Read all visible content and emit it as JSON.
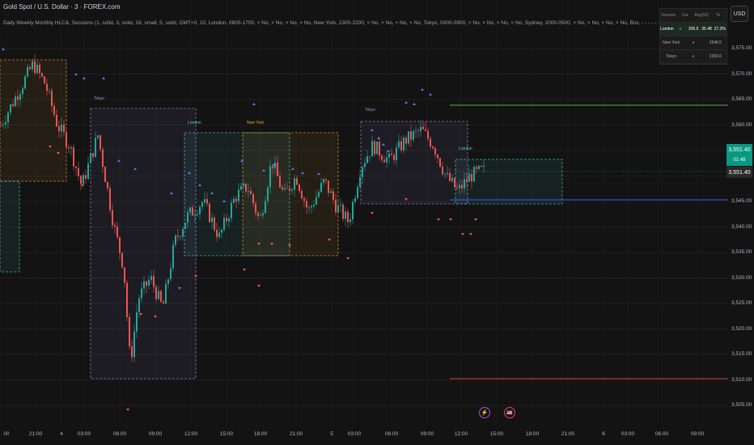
{
  "header": {
    "title": "Gold Spot / U.S. Dollar · 3 · FOREX.com",
    "indicator": "Daily Weekly Monthly HLC&, Sessions (1, solid, 3, solid, 16, small, 5, solid, GMT+0, 10, London, 0800-1700, × No, × No, × No, × No, New York, 1300-2200, × No, × No, × No, × No, Tokyo, 0000-0900, × No, × No, × No, × No, Sydney, 2000-0500, × No, × No, × No, × No, Box, - - - - - -, 1, Small, Top, Outside, 15, small, Red ▾ Green, price, price, white, OHLC, 1, Session color"
  },
  "currency_button": "USD",
  "session_table": {
    "headers": [
      "Session",
      "Cur",
      "Avg(50)",
      "%"
    ],
    "rows": [
      {
        "name": "London",
        "status": "●",
        "cur": "305.5",
        "avg": "35.48",
        "pct": "27.3%",
        "active": true
      },
      {
        "name": "New York",
        "status": "●",
        "cur": "",
        "avg": "2648.5",
        "pct": "",
        "active": false
      },
      {
        "name": "Tokyo",
        "status": "●",
        "cur": "",
        "avg": "2266.6",
        "pct": "",
        "active": false
      }
    ]
  },
  "price_axis": [
    "3,575.00",
    "3,570.00",
    "3,565.00",
    "3,560.00",
    "3,555.00",
    "3,550.00",
    "3,545.00",
    "3,540.00",
    "3,535.00",
    "3,530.00",
    "3,525.00",
    "3,520.00",
    "3,515.00",
    "3,510.00",
    "3,505.00"
  ],
  "current_price": "3,551.40",
  "countdown": "01:48",
  "secondary_price": "3,551.40",
  "time_axis": [
    "00",
    "21:00",
    "4",
    "03:00",
    "06:00",
    "09:00",
    "12:00",
    "15:00",
    "18:00",
    "21:00",
    "5",
    "03:00",
    "06:00",
    "09:00",
    "12:00",
    "15:00",
    "18:00",
    "21:00",
    "6",
    "03:00",
    "06:00",
    "09:00"
  ],
  "session_labels": [
    "Tokyo",
    "London",
    "New York",
    "Tokyo",
    "London"
  ],
  "colors": {
    "up": "#26a69a",
    "down": "#ef5350",
    "tokyo": "#a48be0",
    "london": "#4dd0c8",
    "newyork": "#f0a030",
    "signal_up": "#2962ff"
  },
  "events": [
    "⚡",
    "🇺🇸"
  ]
}
